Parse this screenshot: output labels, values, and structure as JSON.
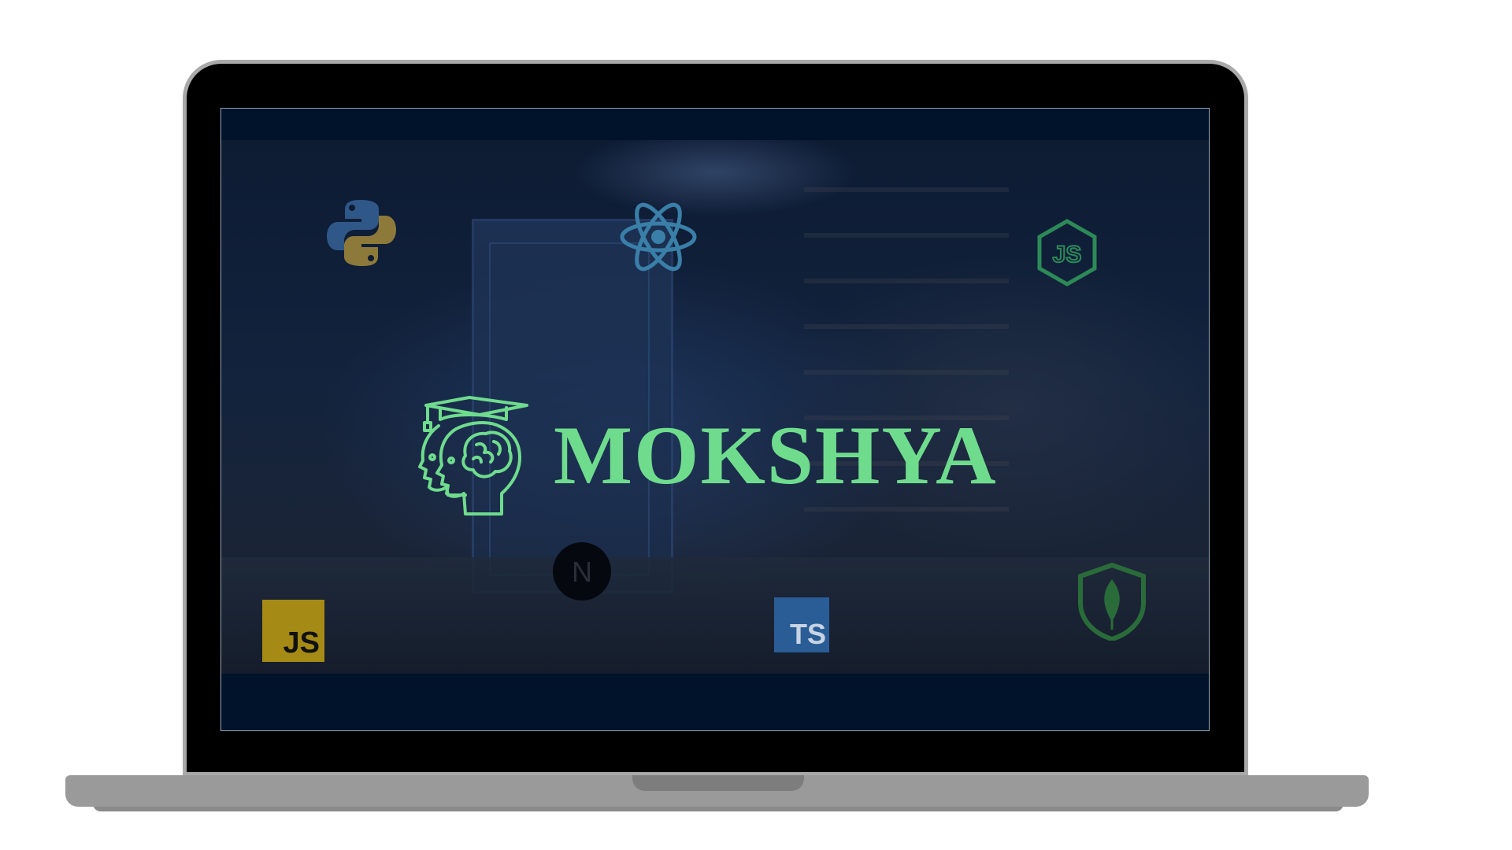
{
  "brand": {
    "name": "MOKSHYA",
    "logo_icon": "graduate-head-brain-icon",
    "color": "#6fdc8d"
  },
  "tech_icons": {
    "python": {
      "icon": "python-icon"
    },
    "react": {
      "icon": "react-icon"
    },
    "nodejs": {
      "icon": "nodejs-icon",
      "label": "JS"
    },
    "nextjs": {
      "icon": "nextjs-icon",
      "label": "N"
    },
    "javascript": {
      "icon": "javascript-icon",
      "label": "JS"
    },
    "typescript": {
      "icon": "typescript-icon",
      "label": "TS"
    },
    "mongodb": {
      "icon": "mongodb-icon"
    }
  },
  "colors": {
    "display_background": "#01122b",
    "laptop_frame": "#000000",
    "laptop_base": "#9a9a9a"
  }
}
